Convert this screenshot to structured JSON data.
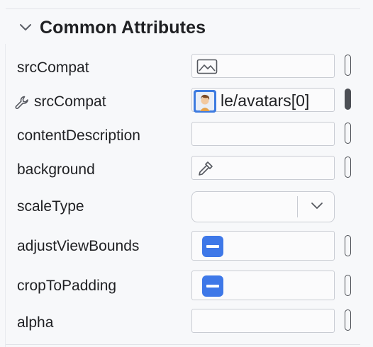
{
  "section": {
    "title": "Common Attributes",
    "expanded": true,
    "toggle_icon": "chevron-down-icon"
  },
  "attributes": [
    {
      "name": "srcCompat",
      "value_type": "image",
      "value": "",
      "icon": "image-icon"
    },
    {
      "name": "srcCompat",
      "value_type": "sample-data",
      "value": "le/avatars[0]",
      "icon": "avatar-thumbnail",
      "prefix_icon": "wrench-icon"
    },
    {
      "name": "contentDescription",
      "value_type": "text",
      "value": ""
    },
    {
      "name": "background",
      "value_type": "color",
      "value": "",
      "icon": "eyedropper-icon"
    },
    {
      "name": "scaleType",
      "value_type": "dropdown",
      "value": "",
      "icon": "chevron-down-icon"
    },
    {
      "name": "adjustViewBounds",
      "value_type": "tristate-checkbox",
      "state": "indeterminate"
    },
    {
      "name": "cropToPadding",
      "value_type": "tristate-checkbox",
      "state": "indeterminate"
    },
    {
      "name": "alpha",
      "value_type": "text",
      "value": ""
    }
  ],
  "colors": {
    "background": "#f7f8fa",
    "accent": "#3e78e8",
    "field_border": "#c9ccd3",
    "text": "#1f2023"
  }
}
